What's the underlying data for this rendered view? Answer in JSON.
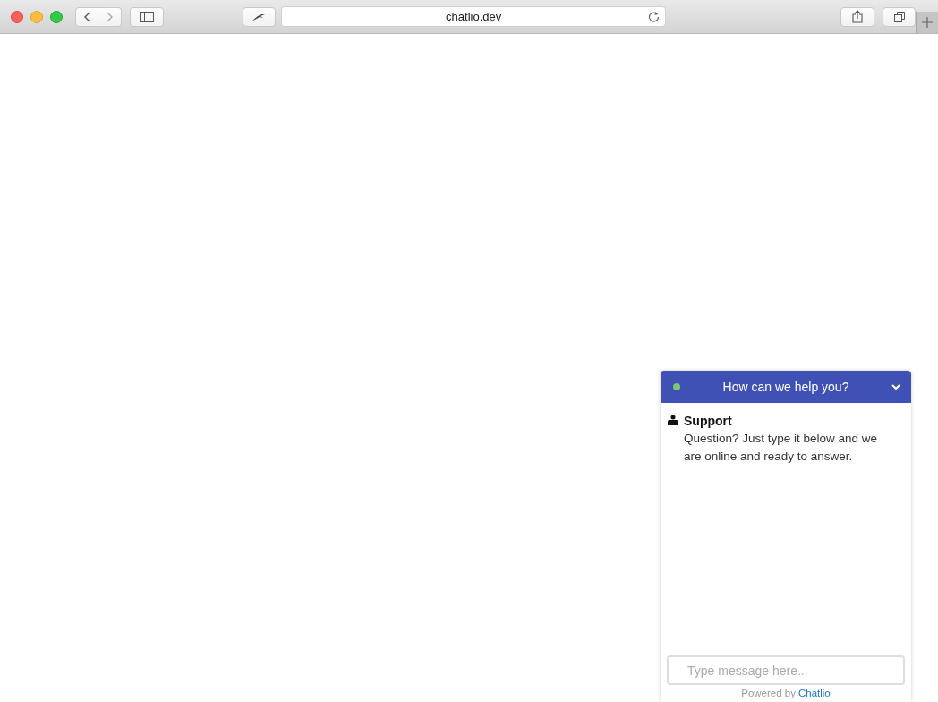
{
  "browser": {
    "url": "chatlio.dev"
  },
  "chat": {
    "title": "How can we help you?",
    "online": true,
    "messages": [
      {
        "sender": "Support",
        "text": "Question? Just type it below and we are online and ready to answer."
      }
    ],
    "input": {
      "placeholder": "Type message here..."
    },
    "footer": {
      "text": "Powered by",
      "link": "Chatlio"
    }
  }
}
